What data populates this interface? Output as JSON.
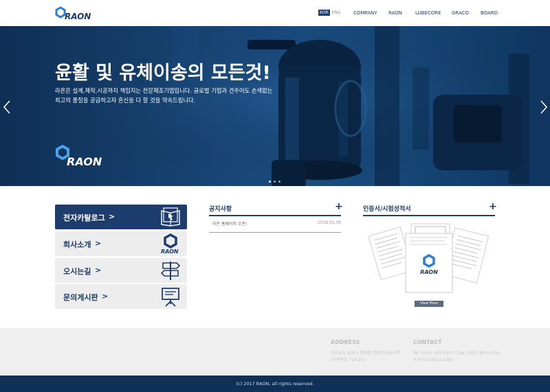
{
  "header": {
    "logo_text": "RAON",
    "lang_kor": "KOR",
    "lang_eng": "ENG",
    "nav": [
      "COMPANY",
      "RAON",
      "LUBECORE",
      "GRACO",
      "BOARD"
    ]
  },
  "hero": {
    "title": "윤활 및 유체이송의 모든것!",
    "desc_line1": "라온은 설계,제작,시공까지 책임지는 전문제조기업입니다. 글로벌 기업과 견주어도 손색없는",
    "desc_line2": "최고의 품질을 공급하고자 혼신을 다 할 것을 약속드립니다.",
    "logo_text": "RAON",
    "slide_count": 3,
    "active_slide": 1
  },
  "quick_links": [
    {
      "label": "전자카탈로그",
      "chevron": ">",
      "icon": "book-icon"
    },
    {
      "label": "회사소개",
      "chevron": ">",
      "icon": "raon-logo-icon"
    },
    {
      "label": "오시는길",
      "chevron": ">",
      "icon": "signpost-icon"
    },
    {
      "label": "문의게시판",
      "chevron": ">",
      "icon": "board-icon"
    }
  ],
  "notice": {
    "title": "공지사항",
    "plus": "+",
    "items": [
      {
        "title": "라온 홈페이지 오픈!",
        "date": "2018.01.09"
      }
    ]
  },
  "certificates": {
    "title": "인증서/시험성적서",
    "plus": "+",
    "logo_text": "RAON",
    "view_more": "View More"
  },
  "footer": {
    "address_title": "ADDRESS",
    "address_line1": "경상남도 김해시 한림읍 한림로206 라온",
    "address_line2": "(우편번호 710-25)",
    "contact_title": "CONTACT",
    "contact_line1": "Tel. (055) 905-0105 / Fax. (055) 905-0106",
    "contact_line2": "H.P 010-8523-2483",
    "copyright": "(c) 2017 RAON, all rights reserved."
  },
  "colors": {
    "brand_navy": "#1d3d6e",
    "hero_blue": "#15406d",
    "footer_dark": "#0f3057",
    "footer_light": "#efefef"
  }
}
